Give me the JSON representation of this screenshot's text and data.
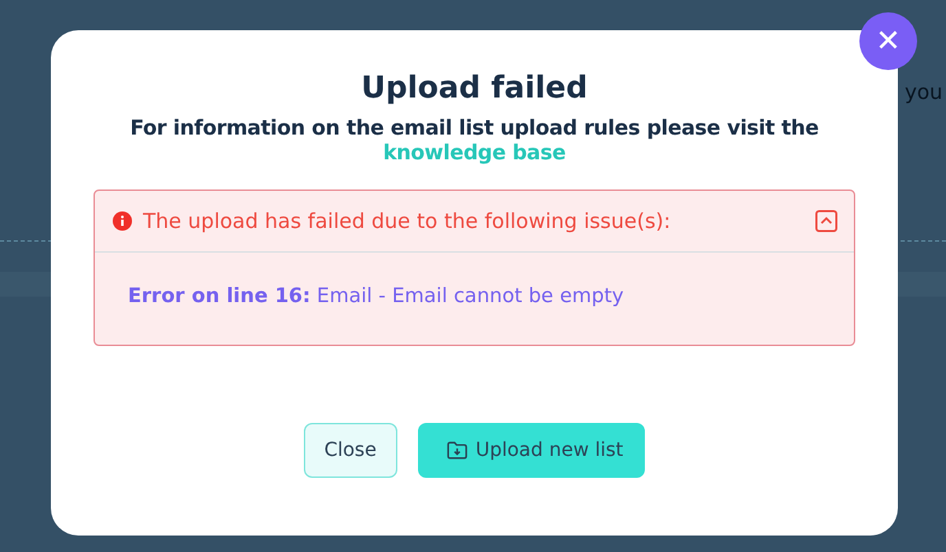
{
  "background": {
    "text_fragment": "you"
  },
  "dialog": {
    "close_icon": "✕",
    "title": "Upload failed",
    "subtitle": "For information on the email list upload rules please visit the",
    "link": "knowledge base",
    "alert": {
      "message": "The upload has failed due to the following issue(s):",
      "expanded": true,
      "errors": [
        {
          "text": "**Error on line 16:** Email - Email cannot be empty"
        }
      ]
    },
    "buttons": [
      {
        "kind": "secondary",
        "label": "Close"
      },
      {
        "kind": "primary",
        "label": "Upload new list"
      }
    ]
  }
}
